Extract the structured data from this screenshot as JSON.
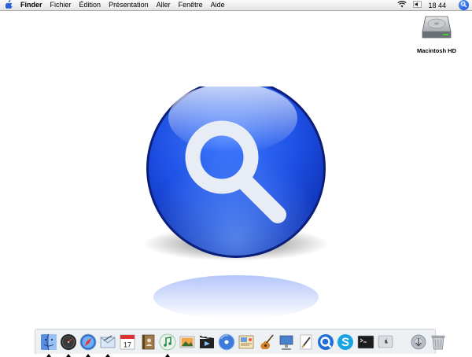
{
  "menubar": {
    "apple_icon": "apple-icon",
    "items": [
      {
        "label": "Finder"
      },
      {
        "label": "Fichier"
      },
      {
        "label": "Édition"
      },
      {
        "label": "Présentation"
      },
      {
        "label": "Aller"
      },
      {
        "label": "Fenêtre"
      },
      {
        "label": "Aide"
      }
    ],
    "status": {
      "wifi_icon": "wifi-icon",
      "volume_icon": "volume-icon",
      "clock": "18 44",
      "spotlight_icon": "spotlight-icon"
    }
  },
  "desktop": {
    "drive": {
      "label": "Macintosh HD",
      "icon": "hard-drive-icon"
    },
    "center_graphic": {
      "icon": "spotlight-magnifier-icon"
    }
  },
  "dock": {
    "calendar_day": "17",
    "apps": [
      {
        "name": "finder",
        "running": true
      },
      {
        "name": "dashboard",
        "running": true
      },
      {
        "name": "safari",
        "running": true
      },
      {
        "name": "mail",
        "running": true
      },
      {
        "name": "ical",
        "running": false
      },
      {
        "name": "address-book",
        "running": false
      },
      {
        "name": "itunes",
        "running": true
      },
      {
        "name": "iphoto",
        "running": false
      },
      {
        "name": "imovie",
        "running": false
      },
      {
        "name": "idvd",
        "running": false
      },
      {
        "name": "iweb",
        "running": false
      },
      {
        "name": "garageband",
        "running": false
      },
      {
        "name": "keynote",
        "running": false
      },
      {
        "name": "pages",
        "running": false
      },
      {
        "name": "quicktime",
        "running": false
      },
      {
        "name": "skype",
        "running": false
      },
      {
        "name": "terminal",
        "running": false
      },
      {
        "name": "system",
        "running": false
      }
    ],
    "right_items": [
      {
        "name": "downloads-stack"
      },
      {
        "name": "trash"
      }
    ]
  }
}
